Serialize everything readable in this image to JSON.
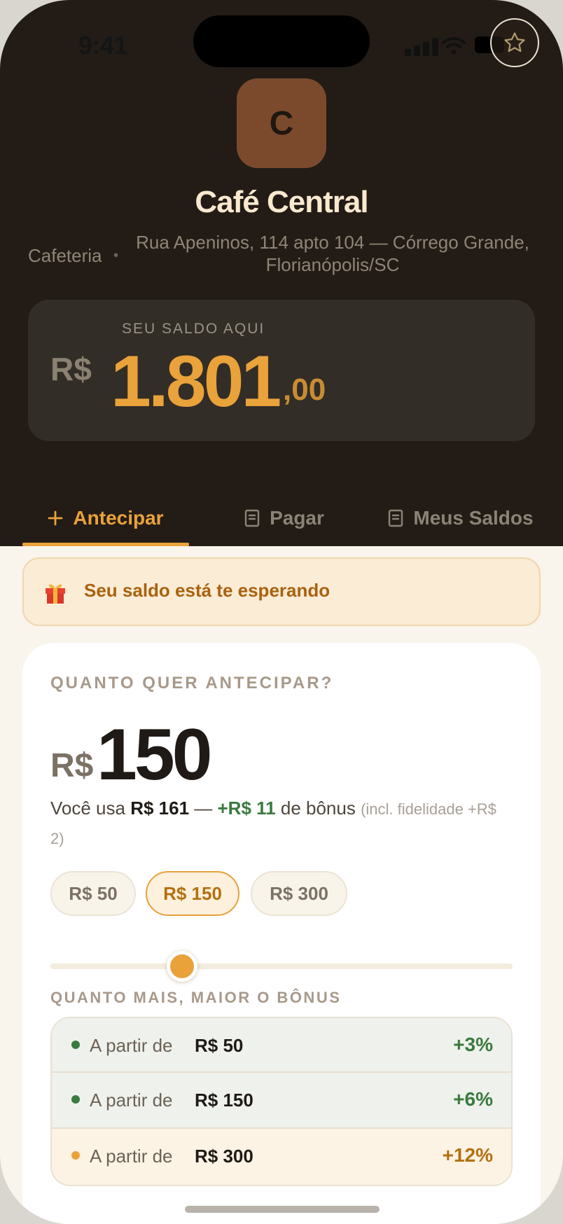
{
  "status_bar": {
    "time": "9:41"
  },
  "store": {
    "logo_letter": "C",
    "name": "Café Central",
    "category": "Cafeteria",
    "address": "Rua Apeninos, 114 apto 104 — Córrego Grande, Florianópolis/SC",
    "favorite_icon": "star-icon"
  },
  "balance": {
    "label": "SEU SALDO AQUI",
    "currency": "R$",
    "integer": "1.801",
    "cents": ",00"
  },
  "tabs": [
    {
      "label": "Antecipar",
      "icon": "plus-icon",
      "active": true
    },
    {
      "label": "Pagar",
      "icon": "receipt-icon",
      "active": false
    },
    {
      "label": "Meus Saldos",
      "icon": "receipt-icon",
      "active": false
    }
  ],
  "banner": {
    "icon": "gift-icon",
    "text": "Seu saldo está te esperando"
  },
  "advance": {
    "question": "QUANTO QUER ANTECIPAR?",
    "currency": "R$",
    "amount": "150",
    "desc_prefix": "Você usa ",
    "desc_used": "R$ 161",
    "desc_dash": " — ",
    "desc_bonus": "+R$ 11",
    "desc_bonus_suffix": " de bônus ",
    "desc_note": "(incl. fidelidade +R$ 2)",
    "chips": [
      {
        "label": "R$ 50",
        "selected": false
      },
      {
        "label": "R$ 150",
        "selected": true
      },
      {
        "label": "R$ 300",
        "selected": false
      }
    ],
    "slider_value": 150,
    "slider_min": 0,
    "slider_max": 500,
    "tiers_title": "QUANTO MAIS, MAIOR O BÔNUS",
    "tiers": [
      {
        "prefix": "A partir de",
        "amount": "R$ 50",
        "bonus": "+3%"
      },
      {
        "prefix": "A partir de",
        "amount": "R$ 150",
        "bonus": "+6%"
      },
      {
        "prefix": "A partir de",
        "amount": "R$ 300",
        "bonus": "+12%"
      }
    ]
  },
  "colors": {
    "accent": "#eaa23a",
    "header_bg": "#231c16",
    "bonus_green": "#3a7a3e",
    "page_bg": "#f9f4ec"
  }
}
